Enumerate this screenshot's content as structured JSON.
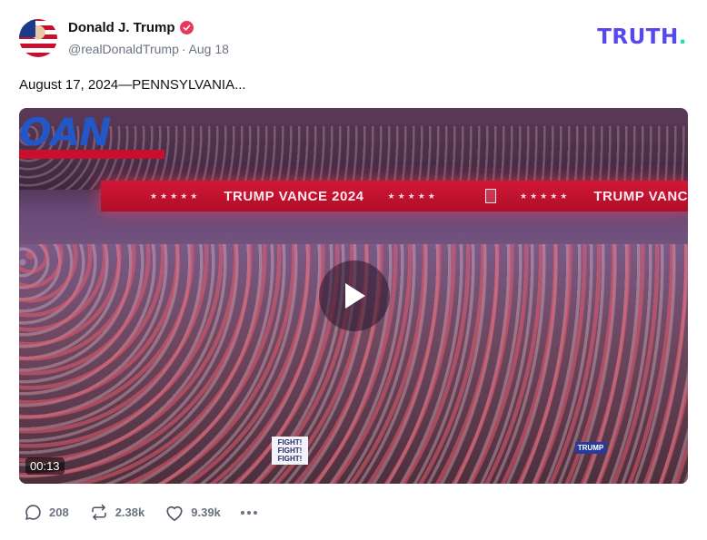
{
  "author": {
    "name": "Donald J. Trump",
    "handle": "@realDonaldTrump",
    "date": "Aug 18",
    "verified": true
  },
  "brand": {
    "logo_main": "TRUTH",
    "logo_dot": ".",
    "color": "#5448ee",
    "accent": "#1ee0b6"
  },
  "post": {
    "text": "August 17, 2024—PENNSYLVANIA..."
  },
  "video": {
    "duration": "00:13",
    "overlay_brand": "OAN",
    "led_text_1": "TRUMP VANCE 2024",
    "led_text_2": "TRUMP VANC",
    "led_stars": "★★★★★",
    "sign_1": "FIGHT! FIGHT! FIGHT!",
    "sign_2": "TRUMP"
  },
  "actions": {
    "replies": "208",
    "retruths": "2.38k",
    "likes": "9.39k"
  },
  "icons": {
    "reply": "reply-icon",
    "retruth": "retruth-icon",
    "like": "heart-icon",
    "more": "more-icon",
    "play": "play-icon",
    "verified": "verified-badge-icon"
  },
  "colors": {
    "verified": "#e8375d",
    "muted": "#6b7280"
  }
}
